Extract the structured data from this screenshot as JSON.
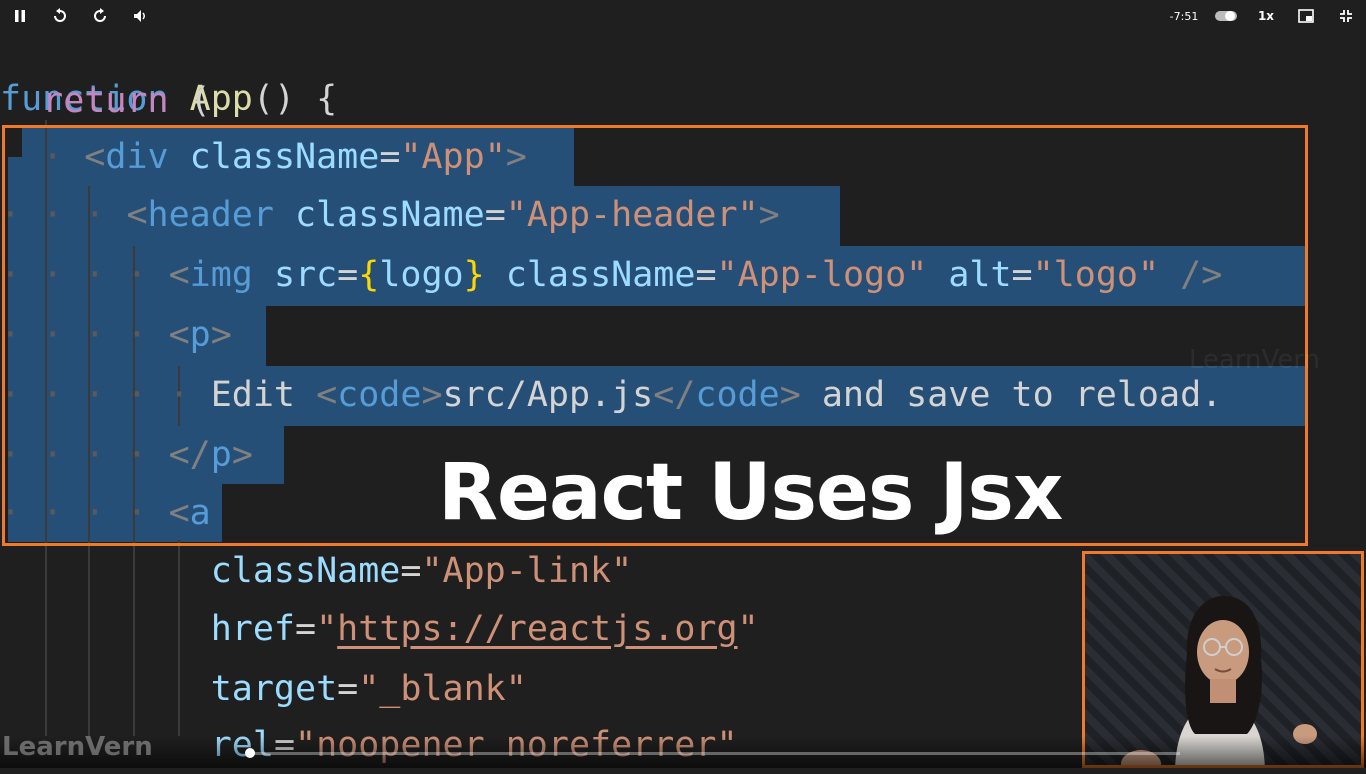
{
  "overlay": {
    "title": "React Uses Jsx",
    "watermark": "LearnVern"
  },
  "code_lines": [
    "function App() {",
    "  return (",
    "    <div className=\"App\">",
    "      <header className=\"App-header\">",
    "        <img src={logo} className=\"App-logo\" alt=\"logo\" />",
    "        <p>",
    "          Edit <code>src/App.js</code> and save to reload.",
    "        </p>",
    "        <a",
    "          className=\"App-link\"",
    "          href=\"https://reactjs.org\"",
    "          target=\"_blank\"",
    "          rel=\"noopener noreferrer\""
  ],
  "tokens": {
    "function": "function",
    "app": "App",
    "parens_brace": "() {",
    "return": "return",
    "open_paren": "(",
    "lt": "<",
    "gt": ">",
    "slash_gt": "/>",
    "lt_slash": "</",
    "div": "div",
    "header": "header",
    "img": "img",
    "p": "p",
    "code": "code",
    "a": "a",
    "className": "className",
    "src": "src",
    "alt": "alt",
    "href": "href",
    "target": "target",
    "rel": "rel",
    "eq": "=",
    "str_app": "\"App\"",
    "str_app_header": "\"App-header\"",
    "str_app_logo": "\"App-logo\"",
    "str_logo": "\"logo\"",
    "logo_expr": "logo",
    "lbrace": "{",
    "rbrace": "}",
    "edit": "Edit ",
    "path": "src/App.js",
    "and_save": " and save to reload.",
    "str_app_link": "\"App-link\"",
    "quote": "\"",
    "url": "https://reactjs.org",
    "str_blank": "\"_blank\"",
    "str_rel": "\"noopener noreferrer\""
  },
  "player": {
    "brand": "LearnVern",
    "time_remaining": "-7:51",
    "speed": "1x",
    "progress": 0.0
  },
  "icons": [
    "pause-icon",
    "rewind-icon",
    "forward-icon",
    "volume-icon",
    "toggle-icon",
    "pip-icon",
    "fullscreen-exit-icon"
  ],
  "colors": {
    "highlight_border": "#f07a2a",
    "selection": "#264f78",
    "background": "#1f1f1f"
  }
}
